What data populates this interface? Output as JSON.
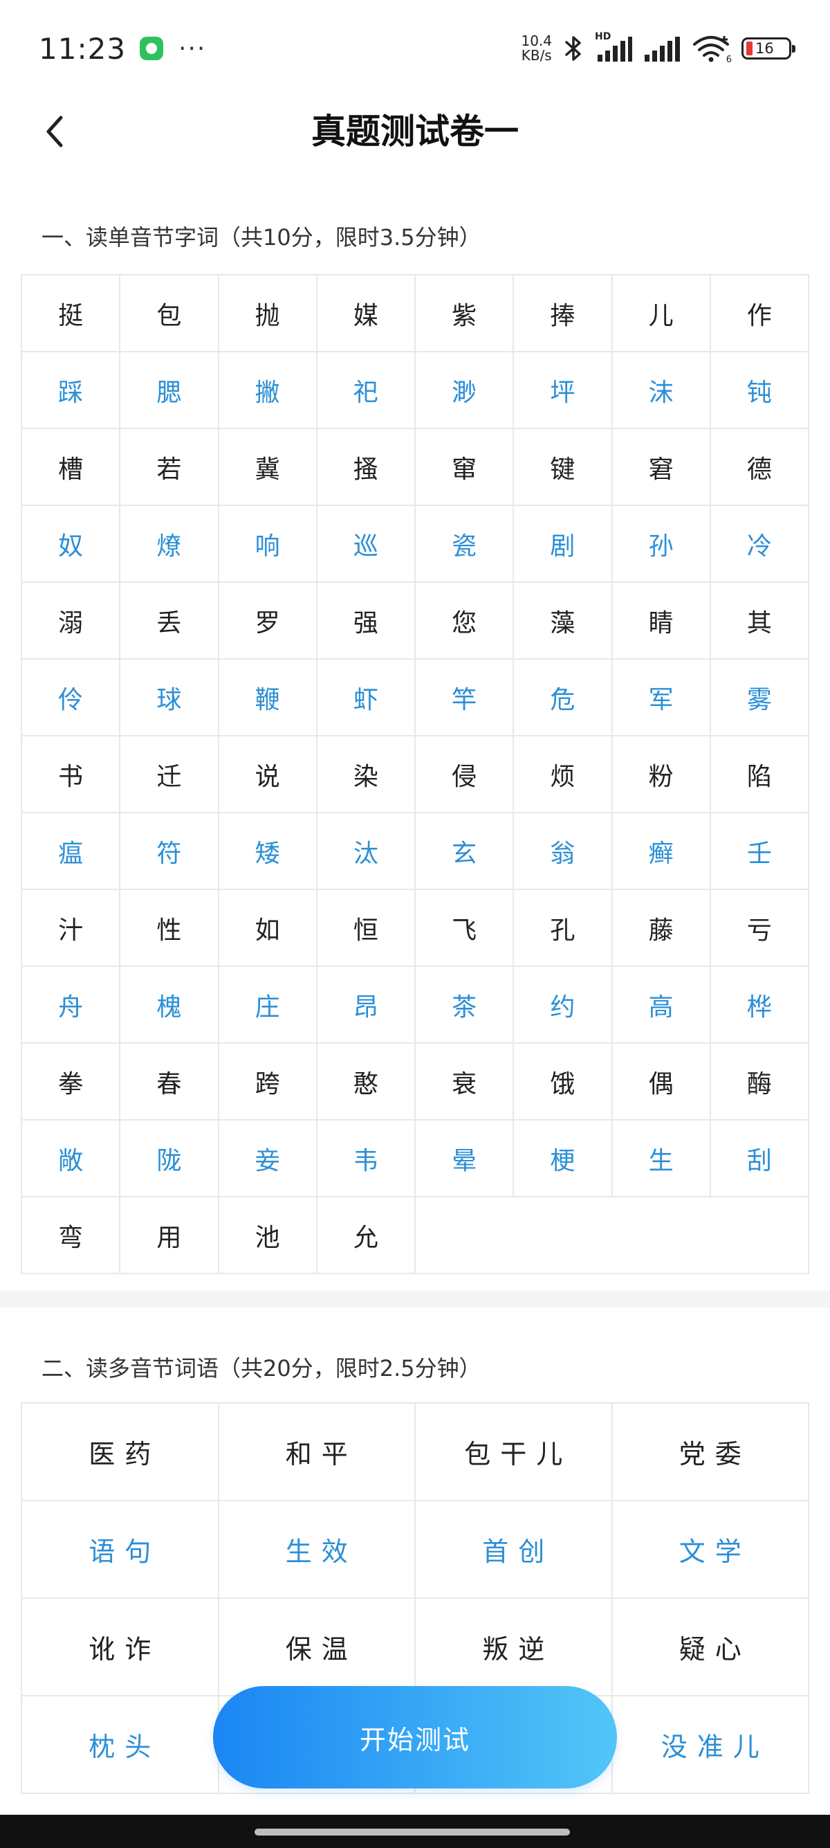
{
  "status_bar": {
    "time": "11:23",
    "dots": "···",
    "speed_top": "10.4",
    "speed_bottom": "KB/s",
    "hd": "HD",
    "wifi_sub": "6",
    "battery": "16"
  },
  "header": {
    "title": "真题测试卷一"
  },
  "section1": {
    "title": "一、读单音节字词（共10分，限时3.5分钟）",
    "rows": [
      {
        "color": "dark",
        "chars": [
          "挺",
          "包",
          "抛",
          "媒",
          "紫",
          "捧",
          "儿",
          "作"
        ]
      },
      {
        "color": "blue",
        "chars": [
          "踩",
          "腮",
          "撇",
          "祀",
          "渺",
          "坪",
          "沫",
          "钝"
        ]
      },
      {
        "color": "dark",
        "chars": [
          "槽",
          "若",
          "冀",
          "搔",
          "窜",
          "键",
          "窘",
          "德"
        ]
      },
      {
        "color": "blue",
        "chars": [
          "奴",
          "燎",
          "响",
          "巡",
          "瓷",
          "剧",
          "孙",
          "冷"
        ]
      },
      {
        "color": "dark",
        "chars": [
          "溺",
          "丢",
          "罗",
          "强",
          "您",
          "藻",
          "睛",
          "其"
        ]
      },
      {
        "color": "blue",
        "chars": [
          "伶",
          "球",
          "鞭",
          "虾",
          "竿",
          "危",
          "军",
          "雾"
        ]
      },
      {
        "color": "dark",
        "chars": [
          "书",
          "迁",
          "说",
          "染",
          "侵",
          "烦",
          "粉",
          "陷"
        ]
      },
      {
        "color": "blue",
        "chars": [
          "瘟",
          "符",
          "矮",
          "汰",
          "玄",
          "翁",
          "癣",
          "壬"
        ]
      },
      {
        "color": "dark",
        "chars": [
          "汁",
          "性",
          "如",
          "恒",
          "飞",
          "孔",
          "藤",
          "亏"
        ]
      },
      {
        "color": "blue",
        "chars": [
          "舟",
          "槐",
          "庄",
          "昂",
          "茶",
          "约",
          "高",
          "桦"
        ]
      },
      {
        "color": "dark",
        "chars": [
          "拳",
          "春",
          "跨",
          "憨",
          "衰",
          "饿",
          "偶",
          "酶"
        ]
      },
      {
        "color": "blue",
        "chars": [
          "敞",
          "陇",
          "妾",
          "韦",
          "晕",
          "梗",
          "生",
          "刮"
        ]
      },
      {
        "color": "dark",
        "chars": [
          "弯",
          "用",
          "池",
          "允"
        ]
      }
    ]
  },
  "section2": {
    "title": "二、读多音节词语（共20分，限时2.5分钟）",
    "rows": [
      {
        "color": "dark",
        "words": [
          "医药",
          "和平",
          "包干儿",
          "党委"
        ]
      },
      {
        "color": "blue",
        "words": [
          "语句",
          "生效",
          "首创",
          "文学"
        ]
      },
      {
        "color": "dark",
        "words": [
          "讹诈",
          "保温",
          "叛逆",
          "疑心"
        ]
      },
      {
        "color": "blue",
        "words": [
          "枕头",
          "",
          "",
          "没准儿"
        ]
      }
    ]
  },
  "start_button": {
    "label": "开始测试"
  },
  "colors": {
    "accent_blue": "#2b8fd6",
    "button_gradient_start": "#1a86f3",
    "button_gradient_end": "#52c6f7",
    "battery_low": "#e53935"
  }
}
